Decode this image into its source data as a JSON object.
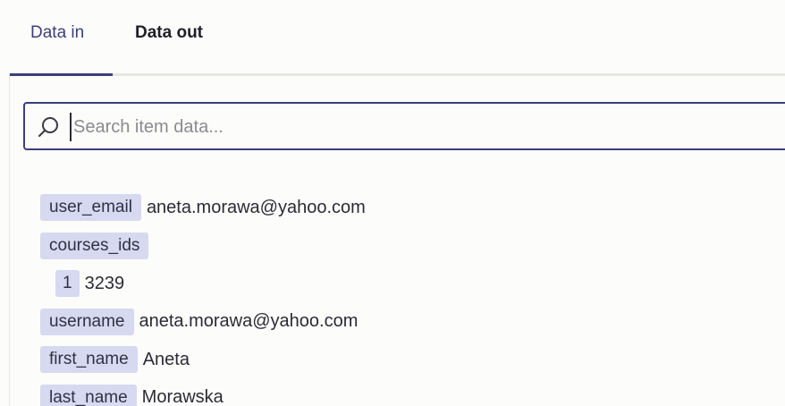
{
  "tabs": [
    {
      "label": "Data in",
      "active": true
    },
    {
      "label": "Data out",
      "active": false
    }
  ],
  "search": {
    "placeholder": "Search item data...",
    "value": ""
  },
  "fields": [
    {
      "key": "user_email",
      "value": "aneta.morawa@yahoo.com"
    },
    {
      "key": "courses_ids",
      "value": ""
    },
    {
      "key": "1",
      "value": "3239"
    },
    {
      "key": "username",
      "value": "aneta.morawa@yahoo.com"
    },
    {
      "key": "first_name",
      "value": "Aneta"
    },
    {
      "key": "last_name",
      "value": "Morawska"
    }
  ],
  "colors": {
    "accent": "#3d3f7a",
    "key_chip_bg": "#d6d9f0",
    "background": "#fcfcfa"
  },
  "icons": {
    "search": "search-icon"
  }
}
